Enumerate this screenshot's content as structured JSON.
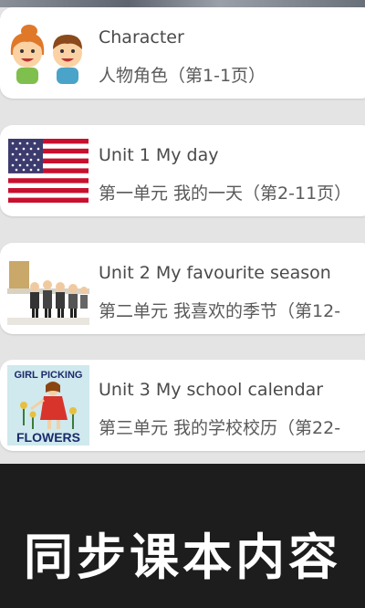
{
  "lessons": [
    {
      "title": "Character",
      "subtitle": "人物角色（第1-1页）",
      "thumb_icon": "children-faces-icon"
    },
    {
      "title": "Unit 1 My day",
      "subtitle": "第一单元 我的一天（第2-11页）",
      "thumb_icon": "us-flag-icon"
    },
    {
      "title": "Unit 2 My favourite season",
      "subtitle": "第二单元 我喜欢的季节（第12-",
      "thumb_icon": "people-queue-icon"
    },
    {
      "title": "Unit 3 My school calendar",
      "subtitle": "第三单元 我的学校校历（第22-",
      "thumb_icon": "girl-picking-flowers-icon",
      "thumb_text_top": "GIRL PICKING",
      "thumb_text_bottom": "FLOWERS"
    }
  ],
  "banner": {
    "text": "同步课本内容"
  },
  "colors": {
    "background": "#e4e4e4",
    "card": "#ffffff",
    "banner": "#1d1d1d",
    "flag_red": "#c8102e",
    "flag_blue": "#3c3b6e"
  }
}
